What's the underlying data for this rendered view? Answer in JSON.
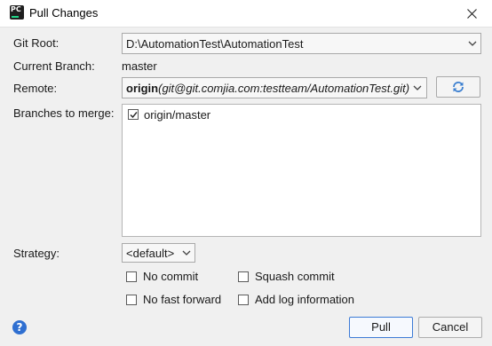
{
  "window": {
    "title": "Pull Changes",
    "icon": "pycharm-app-icon"
  },
  "git_root": {
    "label": "Git Root:",
    "value": "D:\\AutomationTest\\AutomationTest"
  },
  "current_branch": {
    "label": "Current Branch:",
    "value": "master"
  },
  "remote": {
    "label": "Remote:",
    "name": "origin",
    "url": "(git@git.comjia.com:testteam/AutomationTest.git)"
  },
  "branches": {
    "label": "Branches to merge:",
    "items": [
      {
        "name": "origin/master",
        "checked": true
      }
    ]
  },
  "strategy": {
    "label": "Strategy:",
    "value": "<default>"
  },
  "options": {
    "no_commit": "No commit",
    "squash_commit": "Squash commit",
    "no_fast_forward": "No fast forward",
    "add_log": "Add log information"
  },
  "buttons": {
    "pull": "Pull",
    "cancel": "Cancel",
    "help": "?"
  },
  "colors": {
    "accent": "#3d7bd6",
    "help_icon": "#2f6fd1",
    "refresh_icon": "#3b7fd0"
  }
}
